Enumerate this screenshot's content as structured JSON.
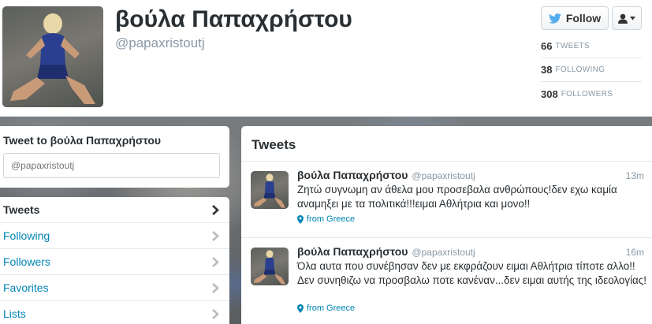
{
  "profile": {
    "name": "βούλα Παπαχρήστου",
    "handle": "@papaxristoutj",
    "follow_label": "Follow",
    "stats": [
      {
        "count": "66",
        "label": "TWEETS"
      },
      {
        "count": "38",
        "label": "FOLLOWING"
      },
      {
        "count": "308",
        "label": "FOLLOWERS"
      }
    ]
  },
  "tweet_to": {
    "title": "Tweet to βούλα Παπαχρήστου",
    "placeholder": "@papaxristoutj"
  },
  "nav": {
    "items": [
      {
        "label": "Tweets",
        "active": true
      },
      {
        "label": "Following"
      },
      {
        "label": "Followers"
      },
      {
        "label": "Favorites"
      },
      {
        "label": "Lists"
      }
    ]
  },
  "timeline": {
    "title": "Tweets",
    "tweets": [
      {
        "name": "βούλα Παπαχρήστου",
        "handle": "@papaxristoutj",
        "time": "13m",
        "text": "Ζητώ συγνωμη αν άθελα μου προσεβαλα ανθρώπους!δεν εχω καμία αναμηξει με τα πολιτικά!!!ειμαι Αθλήτρια και μονο!!",
        "geo": "from Greece"
      },
      {
        "name": "βούλα Παπαχρήστου",
        "handle": "@papaxristoutj",
        "time": "16m",
        "text": "Όλα αυτα που συνέβησαν δεν με εκφράζουν ειμαι Αθλήτρια τίποτε αλλο!!Δεν συνηθιζω να προσβαλω ποτε κανέναν...δεν ειμαι αυτής της ιδεολογίας!",
        "geo": "from Greece"
      }
    ]
  },
  "icons": {
    "follow": "twitter-bird-icon",
    "user_menu": "user-dropdown-icon",
    "nav_chevron": "chevron-right-icon",
    "geo": "location-pin-icon"
  },
  "colors": {
    "link": "#0084b4",
    "bird": "#55acee",
    "text": "#292f33",
    "muted": "#8899a6"
  }
}
